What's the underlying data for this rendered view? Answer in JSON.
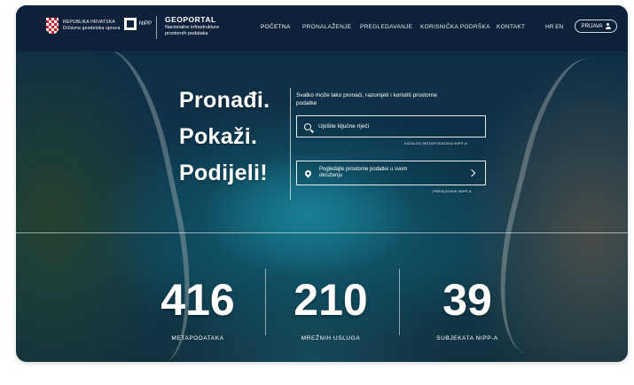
{
  "header": {
    "logo_republika": "REPUBLIKA HRVATSKA",
    "logo_uprava": "Državna geodetska uprava",
    "logo_nipp": "NIPP",
    "geoportal_title": "GEOPORTAL",
    "geoportal_subtitle": "Nacionalne infrastrukture prostornih podataka",
    "nav": [
      "POČETNA",
      "PRONALAŽENJE",
      "PREGLEDAVANJE",
      "KORISNIČKA PODRŠKA",
      "KONTAKT"
    ],
    "lang": "HR  EN",
    "login_label": "PRIJAVA"
  },
  "hero": {
    "tagline": [
      "Pronađi.",
      "Pokaži.",
      "Podijeli!"
    ],
    "intro": "Svatko može lako pronaći, razumjeti i koristiti prostorne podatke",
    "search_placeholder": "Upišite ključne riječi",
    "catalog_link": "KATALOG METAPODATAKA NIPP-A",
    "location_text": "Pogledajte prostorne podatke u svom okruženju",
    "viewer_link": "PREGLEDNIK NIPP-A"
  },
  "stats": [
    {
      "value": "416",
      "label": "METAPODATAKA"
    },
    {
      "value": "210",
      "label": "MREŽNIH USLUGA"
    },
    {
      "value": "39",
      "label": "SUBJEKATA NIPP-A"
    }
  ]
}
